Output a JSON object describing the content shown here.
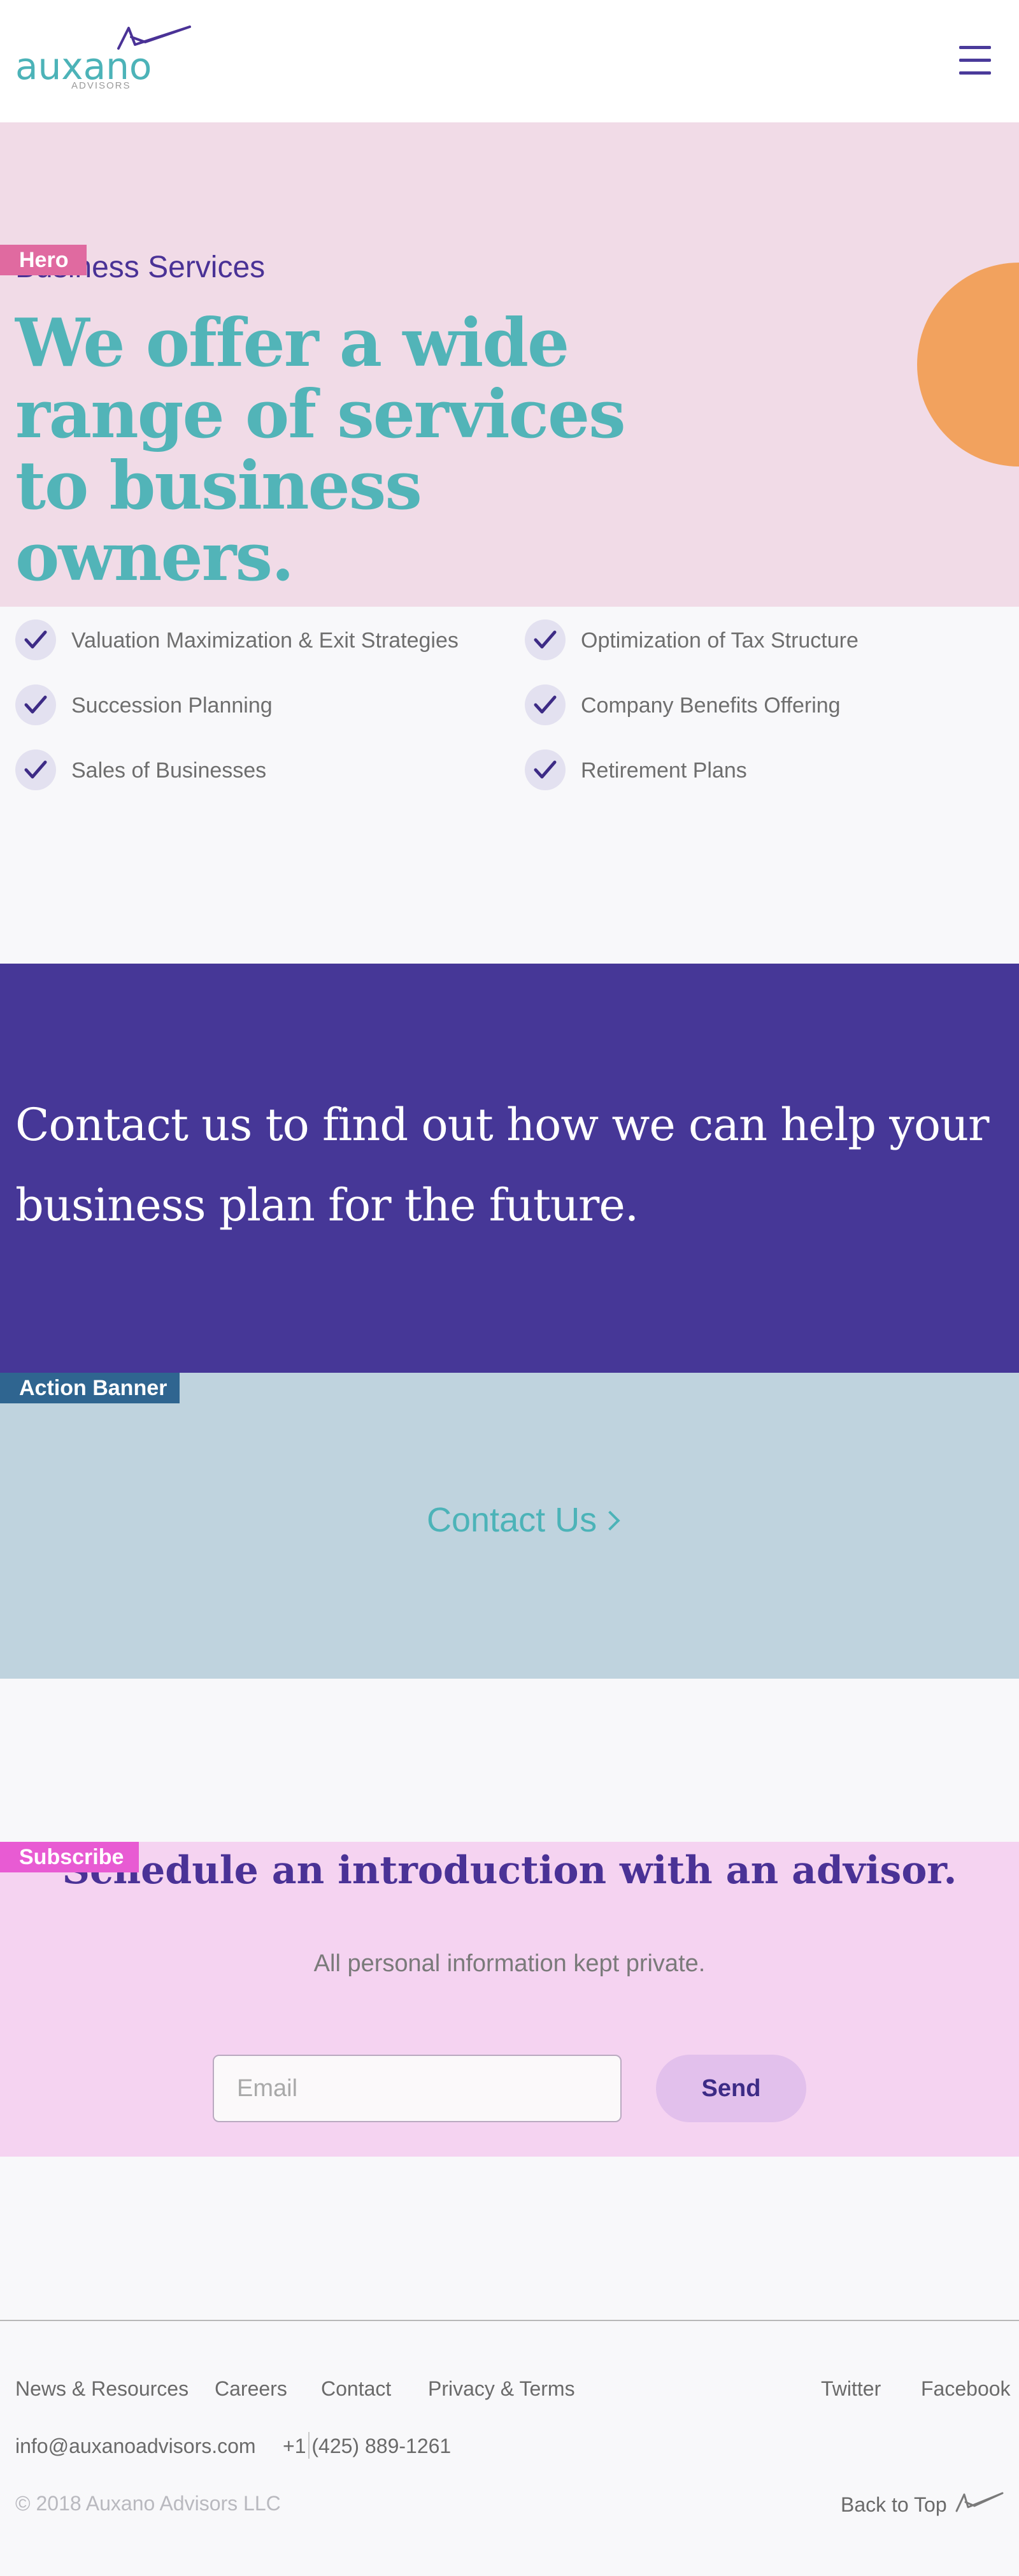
{
  "header": {
    "logo_word": "auxano",
    "logo_sub": "ADVISORS"
  },
  "hero": {
    "tag": "Hero",
    "eyebrow": "Business Services",
    "title": "We offer a wide range of services to business owners."
  },
  "services": [
    "Valuation Maximization & Exit Strategies",
    "Optimization of Tax Structure",
    "Succession Planning",
    "Company Benefits Offering",
    "Sales of Businesses",
    "Retirement Plans"
  ],
  "cta": {
    "text": "Contact us to find out how we can help your business plan for the future."
  },
  "action": {
    "tag": "Action Banner",
    "link_label": "Contact Us"
  },
  "subscribe": {
    "tag": "Subscribe",
    "title": "Schedule an introduction with an advisor.",
    "note": "All personal information kept private.",
    "email_placeholder": "Email",
    "send_label": "Send"
  },
  "footer": {
    "links": [
      "News & Resources",
      "Careers",
      "Contact",
      "Privacy & Terms"
    ],
    "social": [
      "Twitter",
      "Facebook"
    ],
    "email": "info@auxanoadvisors.com",
    "phone": "+1 (425) 889-1261",
    "copyright": "© 2018 Auxano Advisors LLC",
    "back_to_top": "Back to Top"
  },
  "colors": {
    "brand_teal": "#4cb3b8",
    "brand_purple": "#463797",
    "hero_bg": "#f1dbe7",
    "accent_orange": "#f2a25e",
    "action_bg": "#bfd3de",
    "subscribe_bg": "#f5d3f1"
  },
  "icons": {
    "logo": "paper-plane-logo-icon",
    "menu": "hamburger-menu-icon",
    "check": "checkmark-icon",
    "chevron": "chevron-right-icon"
  }
}
